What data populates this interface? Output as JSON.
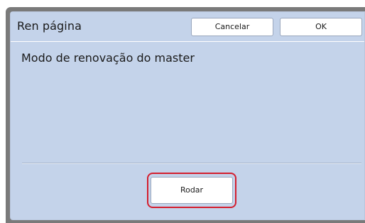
{
  "dialog": {
    "title": "Ren página",
    "cancel_label": "Cancelar",
    "ok_label": "OK",
    "mode_label": "Modo de renovação do master",
    "run_label": "Rodar"
  },
  "colors": {
    "panel_bg": "#c4d3ea",
    "frame": "#7a7a7a",
    "highlight_ring": "#d41e2e"
  }
}
